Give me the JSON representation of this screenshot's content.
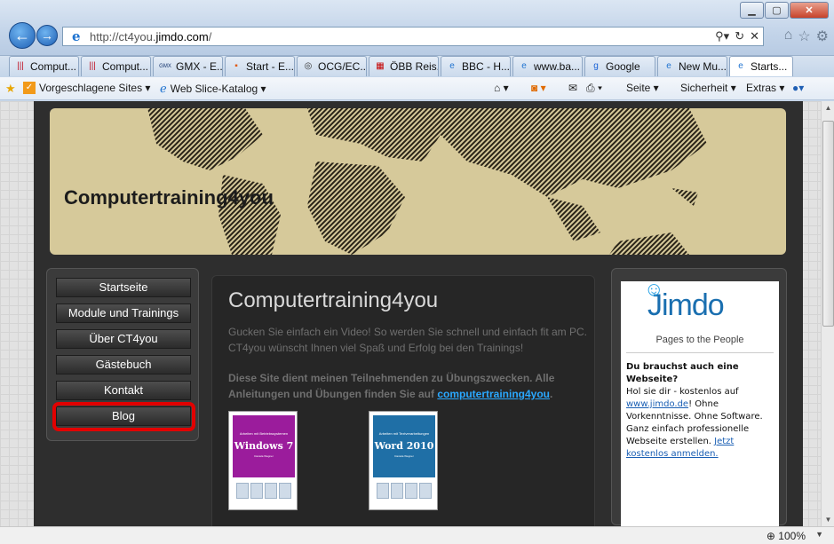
{
  "browser": {
    "url_prefix": "http://ct4you.",
    "url_domain": "jimdo.com",
    "url_suffix": "/",
    "zoom": "100%",
    "tabs": [
      {
        "label": "Comput...",
        "icon": "bars-icon"
      },
      {
        "label": "Comput...",
        "icon": "bars-icon"
      },
      {
        "label": "GMX - E...",
        "icon": "gmx-icon"
      },
      {
        "label": "Start - E...",
        "icon": "derstandard-icon"
      },
      {
        "label": "OCG/EC...",
        "icon": "ocg-icon"
      },
      {
        "label": "ÖBB Reis...",
        "icon": "obb-icon"
      },
      {
        "label": "BBC - H...",
        "icon": "ie-icon"
      },
      {
        "label": "www.ba...",
        "icon": "ie-icon"
      },
      {
        "label": "Google",
        "icon": "google-icon"
      },
      {
        "label": "New Mu...",
        "icon": "ie-icon"
      },
      {
        "label": "Starts...",
        "icon": "ie-icon",
        "active": true
      }
    ],
    "favorites": {
      "suggested": "Vorgeschlagene Sites ▾",
      "webslice": "Web Slice-Katalog ▾"
    },
    "commands": {
      "page": "Seite ▾",
      "safety": "Sicherheit ▾",
      "extras": "Extras ▾"
    }
  },
  "site": {
    "title": "Computertraining4you",
    "nav": [
      "Startseite",
      "Module und Trainings",
      "Über CT4you",
      "Gästebuch",
      "Kontakt",
      "Blog"
    ],
    "heading": "Computertraining4you",
    "intro": "Gucken Sie einfach ein Video! So werden Sie schnell und einfach fit am PC. CT4you wünscht Ihnen viel Spaß und Erfolg bei den Trainings!",
    "notice": "Diese Site dient meinen Teilnehmenden zu Übungszwecken. Alle Anleitungen und Übungen finden Sie auf ",
    "notice_link": "computertraining4you",
    "notice_end": ".",
    "books": [
      {
        "subtitle": "Arbeiten mit Betriebssystemen",
        "title": "Windows 7",
        "author": "Daniela Wagner",
        "color": "#9b1c9c"
      },
      {
        "subtitle": "Arbeiten mit Textverarbeitungen",
        "title": "Word 2010",
        "author": "Daniela Wagner",
        "color": "#1f6fa6"
      }
    ]
  },
  "jimdo": {
    "logo": "Jimdo",
    "tagline": "Pages to the People",
    "heading": "Du brauchst auch eine Webseite?",
    "text1": "Hol sie dir - kostenlos auf ",
    "link1": "www.jimdo.de",
    "text2": "! Ohne Vorkenntnisse. Ohne Software. Ganz einfach professionelle Webseite erstellen. ",
    "link2": "Jetzt kostenlos anmelden."
  }
}
